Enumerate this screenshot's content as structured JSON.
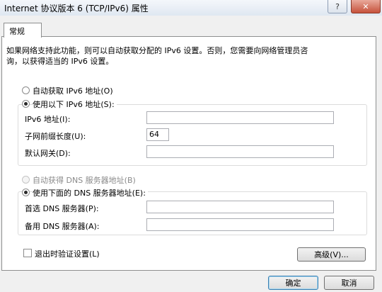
{
  "window": {
    "title": "Internet 协议版本 6 (TCP/IPv6) 属性",
    "help_label": "?",
    "close_label": "✕"
  },
  "tabs": [
    {
      "label": "常规"
    }
  ],
  "description": "如果网络支持此功能，则可以自动获取分配的 IPv6 设置。否则，您需要向网络管理员咨\n询，以获得适当的 IPv6 设置。",
  "ip_section": {
    "auto_label": "自动获取 IPv6 地址(O)",
    "manual_label": "使用以下 IPv6 地址(S):",
    "selected": "manual",
    "fields": [
      {
        "label": "IPv6 地址(I):",
        "value": ""
      },
      {
        "label": "子网前缀长度(U):",
        "value": "64"
      },
      {
        "label": "默认网关(D):",
        "value": ""
      }
    ]
  },
  "dns_section": {
    "auto_label": "自动获得 DNS 服务器地址(B)",
    "auto_disabled": true,
    "manual_label": "使用下面的 DNS 服务器地址(E):",
    "selected": "manual",
    "fields": [
      {
        "label": "首选 DNS 服务器(P):",
        "value": ""
      },
      {
        "label": "备用 DNS 服务器(A):",
        "value": ""
      }
    ]
  },
  "validate_on_exit": {
    "label": "退出时验证设置(L)",
    "checked": false
  },
  "buttons": {
    "advanced": "高级(V)...",
    "ok": "确定",
    "cancel": "取消"
  }
}
